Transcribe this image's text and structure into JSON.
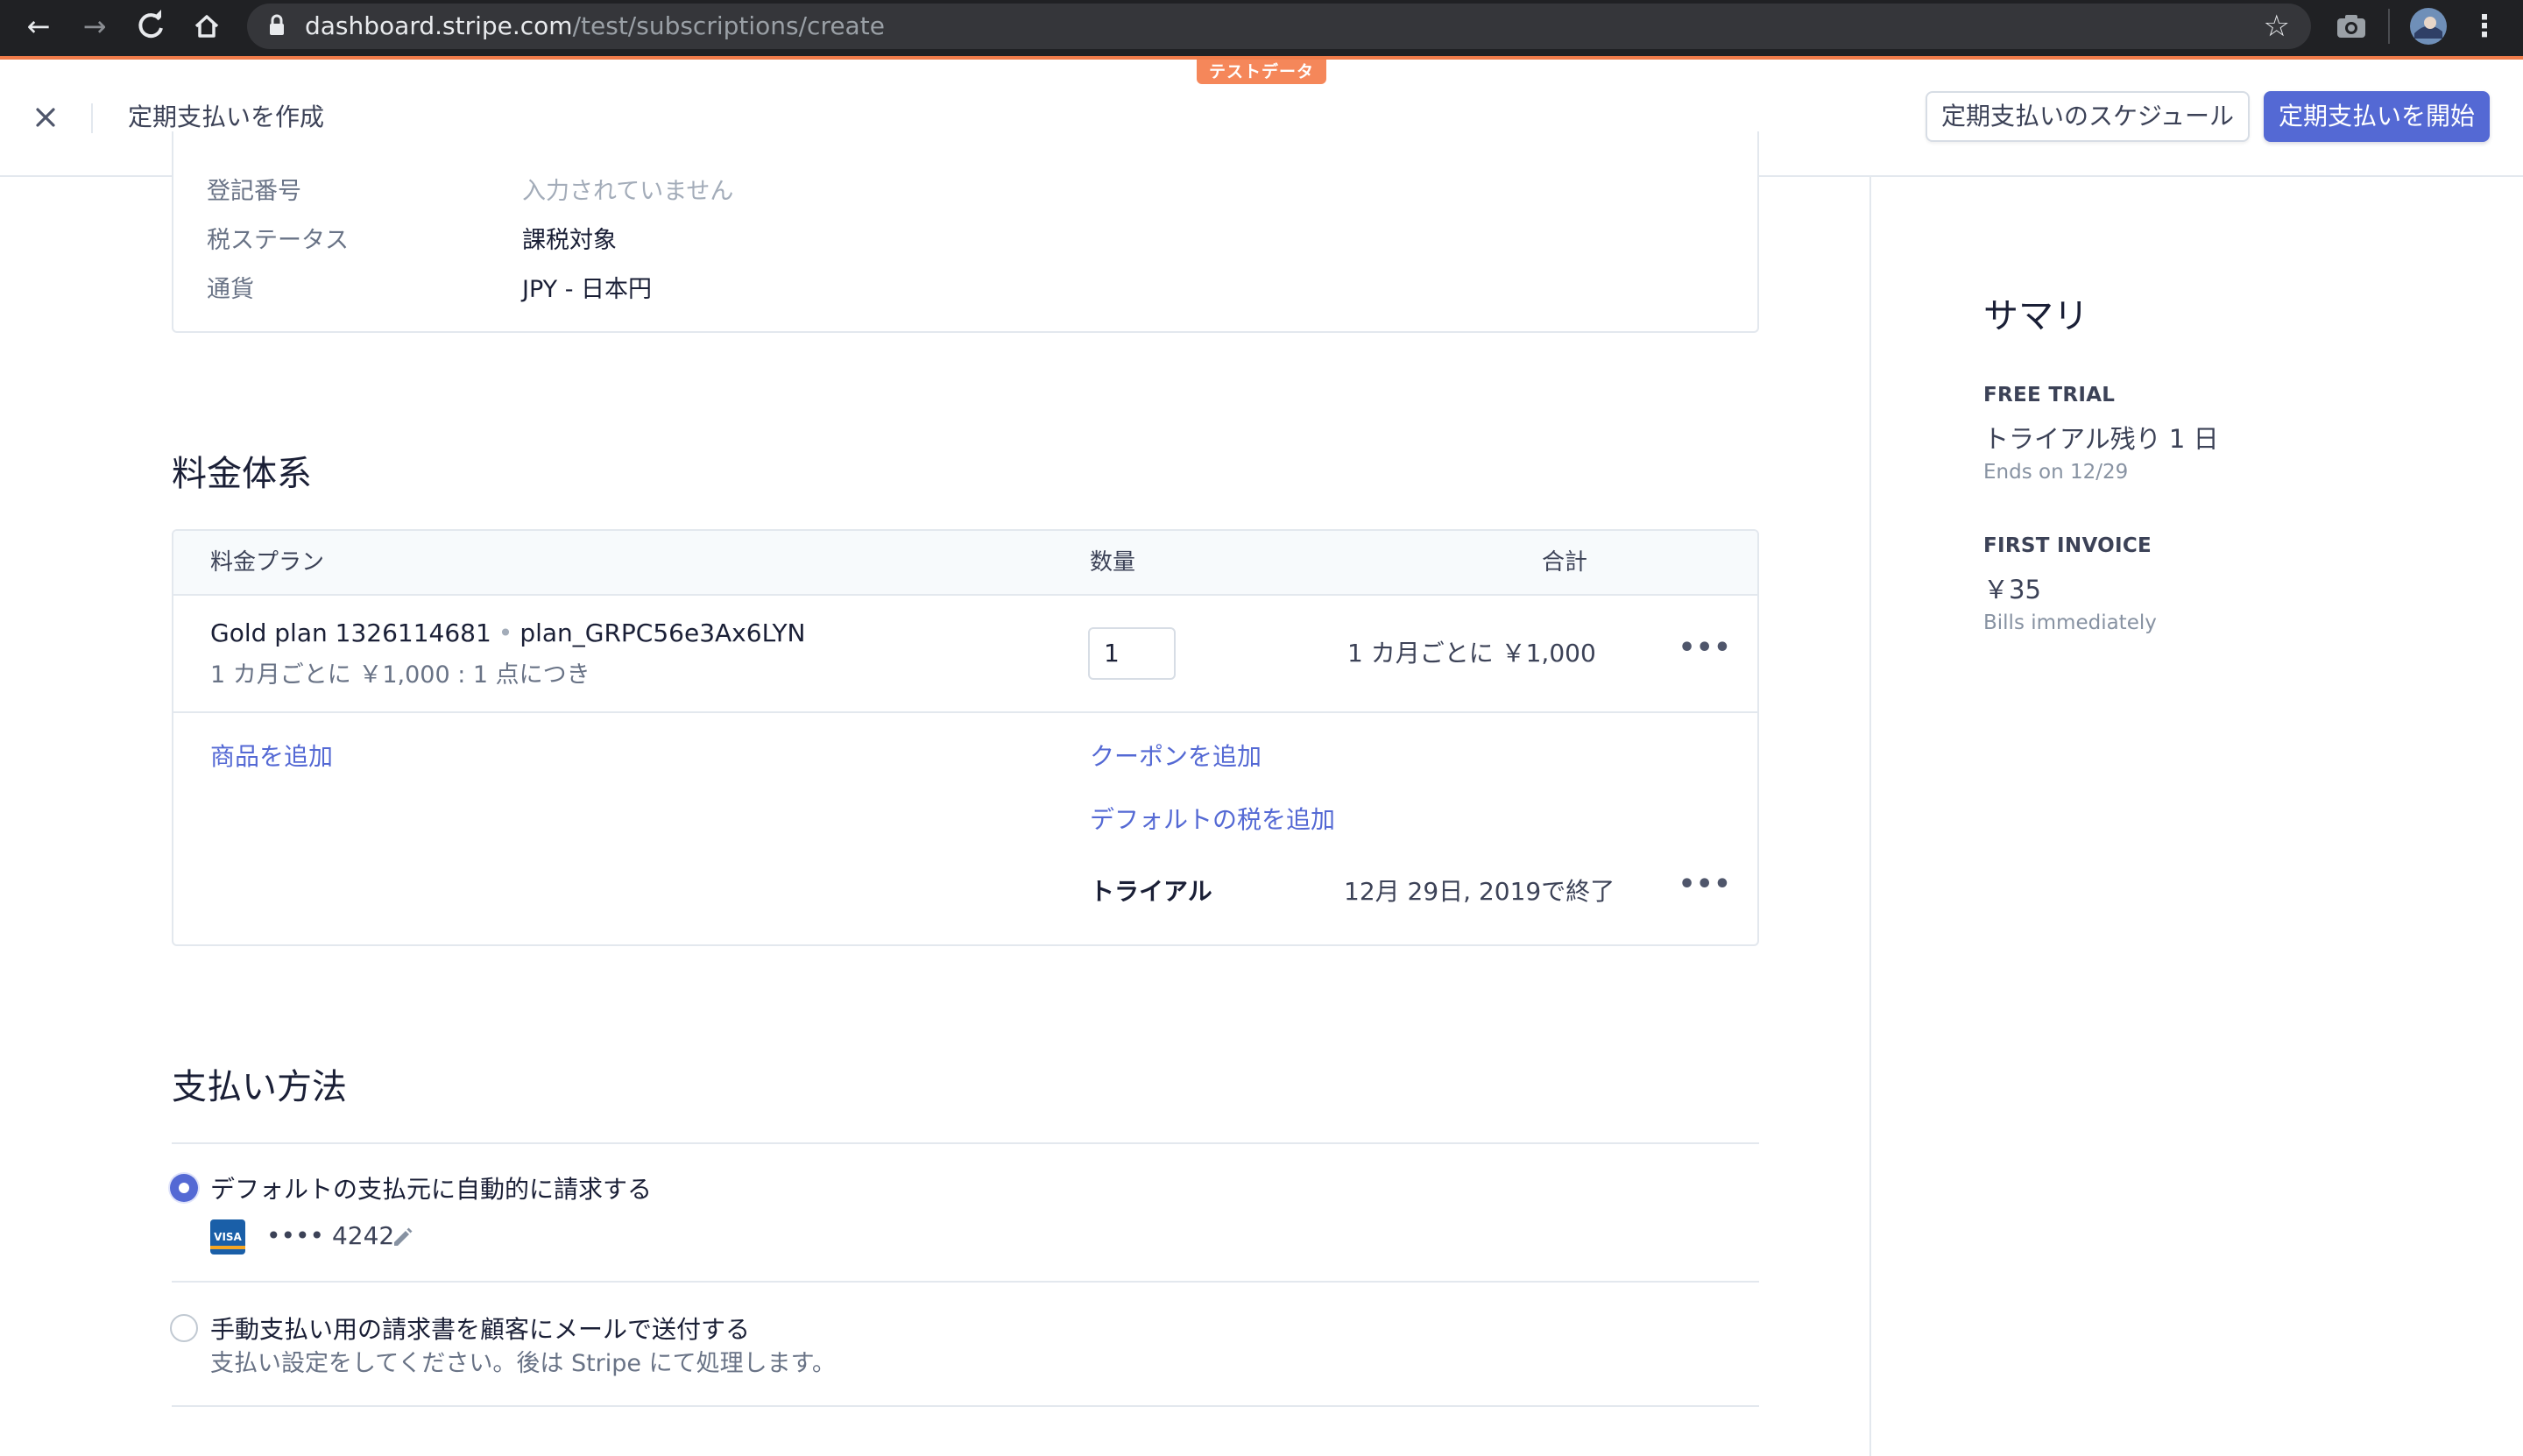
{
  "browser": {
    "url_host": "dashboard.stripe.com",
    "url_path": "/test/subscriptions/create"
  },
  "header": {
    "test_badge": "テストデータ",
    "title": "定期支払いを作成",
    "schedule_button": "定期支払いのスケジュール",
    "start_button": "定期支払いを開始"
  },
  "customer_details": {
    "rows": [
      {
        "label": "登記番号",
        "value": "入力されていません"
      },
      {
        "label": "税ステータス",
        "value": "課税対象"
      },
      {
        "label": "通貨",
        "value": "JPY - 日本円"
      }
    ]
  },
  "pricing": {
    "title": "料金体系",
    "columns": {
      "plan": "料金プラン",
      "quantity": "数量",
      "total": "合計"
    },
    "item": {
      "name": "Gold plan 1326114681",
      "separator": "•",
      "plan_id": "plan_GRPC56e3Ax6LYN",
      "description": "1 カ月ごとに ￥1,000 : 1 点につき",
      "quantity": "1",
      "total": "1 カ月ごとに ￥1,000"
    },
    "add_product": "商品を追加",
    "add_coupon": "クーポンを追加",
    "add_default_tax": "デフォルトの税を追加",
    "trial_label": "トライアル",
    "trial_value": "12月 29日, 2019で終了"
  },
  "payment": {
    "title": "支払い方法",
    "option_auto": "デフォルトの支払元に自動的に請求する",
    "card_brand": "VISA",
    "card_number": "•••• 4242",
    "option_email": "手動支払い用の請求書を顧客にメールで送付する",
    "option_email_sub": "支払い設定をしてください。後は Stripe にて処理します。",
    "selected": "auto"
  },
  "summary": {
    "title": "サマリ",
    "trial_caption": "FREE TRIAL",
    "trial_main": "トライアル残り 1 日",
    "trial_sub": "Ends on 12/29",
    "invoice_caption": "FIRST INVOICE",
    "invoice_main": "￥35",
    "invoice_sub": "Bills immediately"
  },
  "colors": {
    "accent": "#5469d4",
    "test_badge": "#f5875a",
    "chrome_bg": "#202124"
  }
}
